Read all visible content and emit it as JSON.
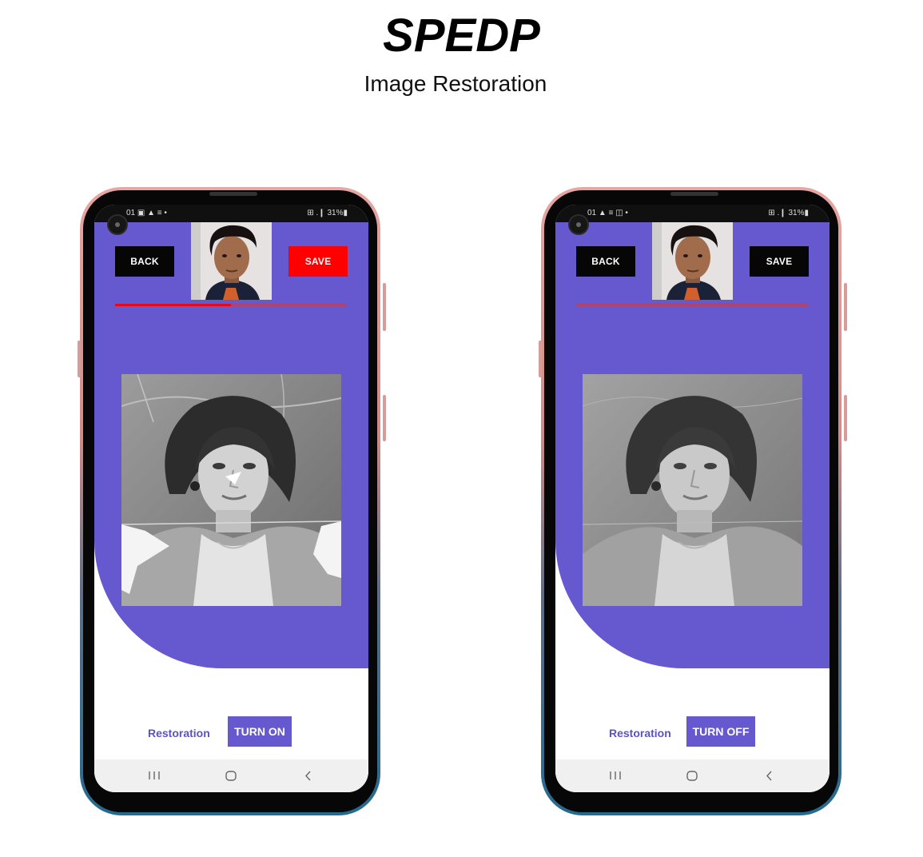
{
  "header": {
    "title": "SPEDP",
    "subtitle": "Image Restoration"
  },
  "colors": {
    "accent_purple": "#6658cf",
    "save_red": "#ff0000",
    "progress_red": "#e5091a",
    "button_black": "#060606"
  },
  "phones": [
    {
      "status": {
        "left": "01 ▣ ▲ ≡ •",
        "right": "⊞ .❙ 31%▮"
      },
      "back_label": "BACK",
      "save_label": "SAVE",
      "save_color": "#ff0000",
      "progress": 0.5,
      "photo_state": "damaged",
      "control_label": "Restoration",
      "toggle_label": "TURN ON",
      "nav_icons": [
        "recents-icon",
        "home-icon",
        "back-arrow-icon"
      ]
    },
    {
      "status": {
        "left": "01 ▲ ≡ ◫ •",
        "right": "⊞ .❙ 31%▮"
      },
      "back_label": "BACK",
      "save_label": "SAVE",
      "save_color": "#060606",
      "progress": 0,
      "photo_state": "restored",
      "control_label": "Restoration",
      "toggle_label": "TURN OFF",
      "nav_icons": [
        "recents-icon",
        "home-icon",
        "back-arrow-icon"
      ]
    }
  ]
}
